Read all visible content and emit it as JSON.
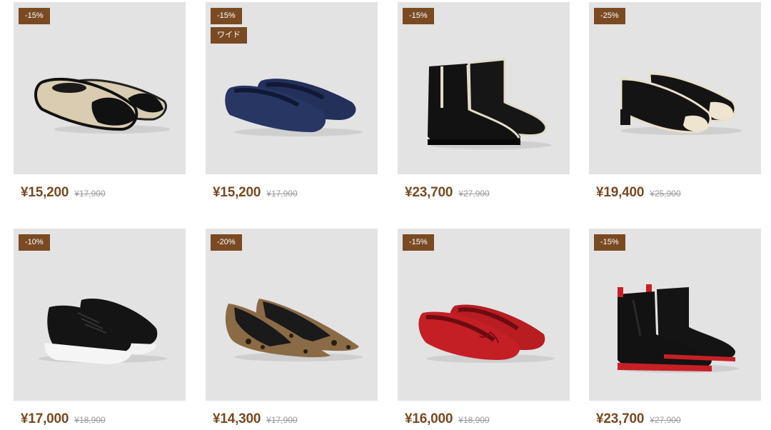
{
  "products": [
    {
      "badges": [
        "-15%"
      ],
      "price": "¥15,200",
      "original": "¥17,900",
      "image": "cream-black-bow-flat"
    },
    {
      "badges": [
        "-15%",
        "ワイド"
      ],
      "price": "¥15,200",
      "original": "¥17,900",
      "image": "navy-knit-flat"
    },
    {
      "badges": [
        "-15%"
      ],
      "price": "¥23,700",
      "original": "¥27,900",
      "image": "black-ankle-boot-cream-trim"
    },
    {
      "badges": [
        "-25%"
      ],
      "price": "¥19,400",
      "original": "¥25,900",
      "image": "black-cream-block-heel-pump"
    },
    {
      "badges": [
        "-10%"
      ],
      "price": "¥17,000",
      "original": "¥18,900",
      "image": "black-knit-sneaker-white-sole"
    },
    {
      "badges": [
        "-20%"
      ],
      "price": "¥14,300",
      "original": "¥17,900",
      "image": "leopard-pointed-flat"
    },
    {
      "badges": [
        "-15%"
      ],
      "price": "¥16,000",
      "original": "¥18,900",
      "image": "red-ballet-flat-bow"
    },
    {
      "badges": [
        "-15%"
      ],
      "price": "¥23,700",
      "original": "¥27,900",
      "image": "black-chelsea-boot-red-sole"
    }
  ],
  "colors": {
    "badge": "#7a4a22",
    "tile": "#e3e3e3",
    "price": "#7a4a22",
    "original": "#9a9a9a"
  }
}
